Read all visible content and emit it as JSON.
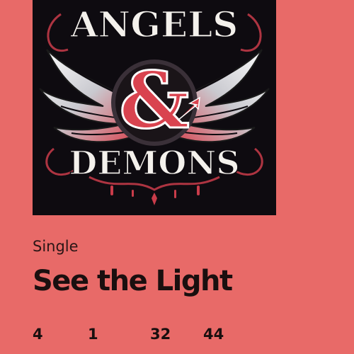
{
  "album": {
    "cover_icon": "album-cover-art",
    "cover_title_top": "ANGELS",
    "cover_ampersand": "&",
    "cover_title_bottom": "DEMONS",
    "release_type": "Single",
    "title": "See the Light"
  },
  "stats": [
    "4",
    "1",
    "32",
    "44"
  ],
  "colors": {
    "background": "#e86a68",
    "cover_background": "#0e0b10",
    "accent_red": "#d9434f",
    "text": "#1a0f0f"
  }
}
